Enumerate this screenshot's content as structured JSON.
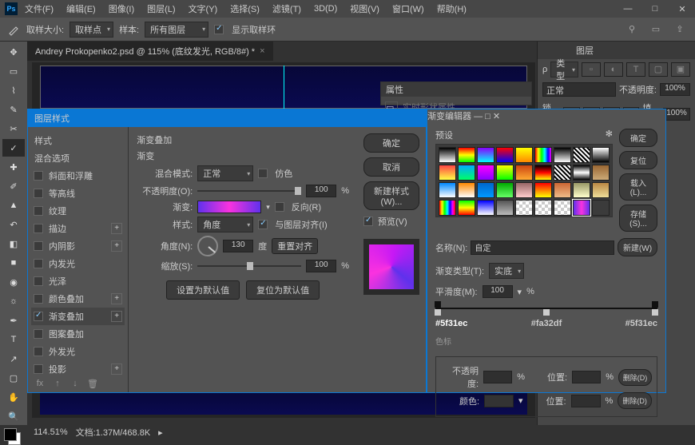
{
  "menu": {
    "file": "文件(F)",
    "edit": "编辑(E)",
    "image": "图像(I)",
    "layer": "图层(L)",
    "type": "文字(Y)",
    "select": "选择(S)",
    "filter": "滤镜(T)",
    "threed": "3D(D)",
    "view": "视图(V)",
    "window": "窗口(W)",
    "help": "帮助(H)"
  },
  "opt": {
    "sample_size_lbl": "取样大小:",
    "sample_size_val": "取样点",
    "sample_lbl": "样本:",
    "sample_val": "所有图层",
    "show_ring": "显示取样环"
  },
  "doc": {
    "tab": "Andrey Prokopenko2.psd @ 115% (底纹发光, RGB/8#) *"
  },
  "layers_panel": {
    "title": "图层",
    "kind": "类型",
    "mode": "正常",
    "opacity_lbl": "不透明度:",
    "opacity": "100%",
    "lock_lbl": "锁定:",
    "fill_lbl": "填充:",
    "fill": "100%"
  },
  "prop": {
    "tab": "属性",
    "mask_lbl": "实时形状属性"
  },
  "layer_style": {
    "title": "图层样式",
    "left_header": "样式",
    "blend_opt": "混合选项",
    "rows": [
      "斜面和浮雕",
      "等高线",
      "纹理",
      "描边",
      "内阴影",
      "内发光",
      "光泽",
      "颜色叠加",
      "渐变叠加",
      "图案叠加",
      "外发光",
      "投影"
    ],
    "section_hdr": "渐变叠加",
    "sub_hdr": "渐变",
    "blend_mode_lbl": "混合模式:",
    "blend_mode": "正常",
    "dither": "仿色",
    "opacity_lbl": "不透明度(O):",
    "opacity": "100",
    "pct": "%",
    "gradient_lbl": "渐变:",
    "reverse": "反向(R)",
    "style_lbl": "样式:",
    "style": "角度",
    "align": "与图层对齐(I)",
    "angle_lbl": "角度(N):",
    "angle": "130",
    "deg": "度",
    "reset_align": "重置对齐",
    "scale_lbl": "缩放(S):",
    "scale": "100",
    "make_default": "设置为默认值",
    "reset_default": "复位为默认值",
    "ok": "确定",
    "cancel": "取消",
    "new_style": "新建样式(W)...",
    "preview": "预览(V)"
  },
  "grad_edit": {
    "title": "渐变编辑器",
    "presets": "预设",
    "gear": "✻",
    "ok": "确定",
    "cancel": "复位",
    "load": "载入(L)...",
    "save": "存储(S)...",
    "name_lbl": "名称(N):",
    "name": "自定",
    "new": "新建(W)",
    "type_lbl": "渐变类型(T):",
    "type": "实底",
    "smooth_lbl": "平滑度(M):",
    "smooth": "100",
    "pct": "%",
    "stops": {
      "left": "#5f31ec",
      "mid": "#fa32df",
      "right": "#5f31ec"
    },
    "color_stops_hdr": "色标",
    "opac_lbl": "不透明度:",
    "loc_lbl": "位置:",
    "del": "删除(D)",
    "color_lbl": "颜色:"
  },
  "chart_data": {
    "type": "gradient",
    "angle": 130,
    "stops": [
      {
        "position": 0,
        "color": "#5f31ec"
      },
      {
        "position": 50,
        "color": "#fa32df"
      },
      {
        "position": 100,
        "color": "#5f31ec"
      }
    ]
  },
  "status": {
    "zoom": "114.51%",
    "doc": "文档:1.37M/468.8K"
  }
}
